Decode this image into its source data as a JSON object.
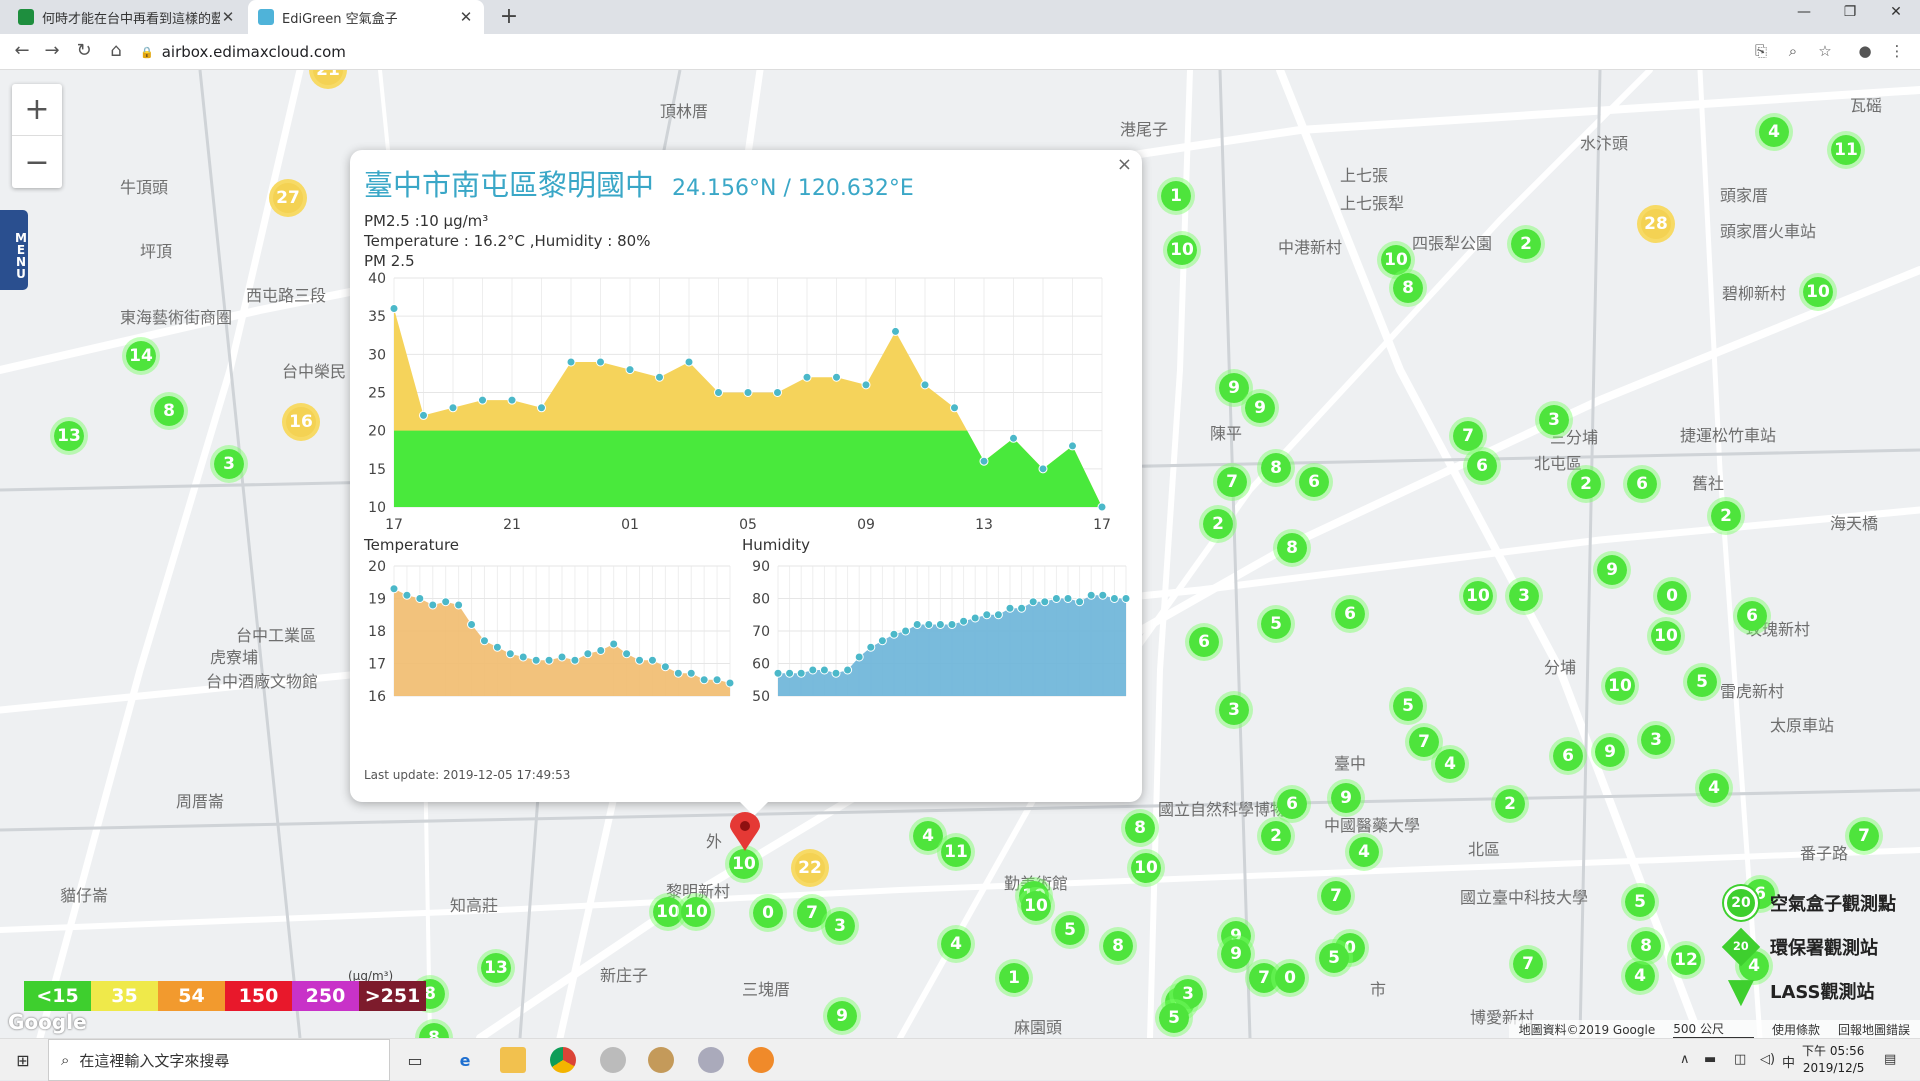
{
  "browser": {
    "tabs": [
      {
        "title": "何時才能在台中再看到這樣的藍天",
        "favicon_color": "#1e8e3e"
      },
      {
        "title": "EdiGreen 空氣盒子",
        "favicon_color": "#4fb3d9"
      }
    ],
    "url": "airbox.edimaxcloud.com"
  },
  "map": {
    "menu_label": "MENU",
    "zoom_in": "+",
    "zoom_out": "−",
    "places": [
      "頂林厝",
      "港尾子",
      "水汴頭",
      "瓦磘",
      "牛頂頭",
      "坪頂",
      "東海藝術街商圈",
      "西屯路三段",
      "上七張",
      "上七張犁",
      "中港新村",
      "四張犁公園",
      "頭家厝",
      "頭家厝火車站",
      "碧柳新村",
      "陳平",
      "北屯區",
      "三分埔",
      "捷運松竹車站",
      "舊社",
      "海天橋",
      "台中工業區",
      "虎寮埔",
      "台中酒廠文物館",
      "玫瑰新村",
      "分埔",
      "雷虎新村",
      "臺中",
      "太原車站",
      "周厝崙",
      "貓仔崙",
      "知高莊",
      "黎明新村",
      "三塊厝",
      "新庄子",
      "國立自然科學博物館",
      "中國醫藥大學",
      "北區",
      "國立臺中科技大學",
      "番子路",
      "勤美術館",
      "麻園頭",
      "博愛新村",
      "市",
      "外",
      "台中榮民"
    ],
    "markers": [
      {
        "v": "21",
        "c": "y"
      },
      {
        "v": "27",
        "c": "y"
      },
      {
        "v": "14",
        "c": "g"
      },
      {
        "v": "8",
        "c": "g"
      },
      {
        "v": "13",
        "c": "g"
      },
      {
        "v": "3",
        "c": "g"
      },
      {
        "v": "16",
        "c": "y"
      },
      {
        "v": "1",
        "c": "g"
      },
      {
        "v": "10",
        "c": "g"
      },
      {
        "v": "10",
        "c": "g"
      },
      {
        "v": "8",
        "c": "g"
      },
      {
        "v": "2",
        "c": "g"
      },
      {
        "v": "28",
        "c": "y"
      },
      {
        "v": "10",
        "c": "g"
      },
      {
        "v": "4",
        "c": "g"
      },
      {
        "v": "11",
        "c": "g"
      },
      {
        "v": "9",
        "c": "g"
      },
      {
        "v": "9",
        "c": "g"
      },
      {
        "v": "7",
        "c": "g"
      },
      {
        "v": "6",
        "c": "g"
      },
      {
        "v": "3",
        "c": "g"
      },
      {
        "v": "2",
        "c": "g"
      },
      {
        "v": "6",
        "c": "g"
      },
      {
        "v": "2",
        "c": "g"
      },
      {
        "v": "7",
        "c": "g"
      },
      {
        "v": "8",
        "c": "g"
      },
      {
        "v": "6",
        "c": "g"
      },
      {
        "v": "2",
        "c": "g"
      },
      {
        "v": "8",
        "c": "g"
      },
      {
        "v": "9",
        "c": "g"
      },
      {
        "v": "10",
        "c": "g"
      },
      {
        "v": "3",
        "c": "g"
      },
      {
        "v": "0",
        "c": "g"
      },
      {
        "v": "10",
        "c": "g"
      },
      {
        "v": "6",
        "c": "g"
      },
      {
        "v": "5",
        "c": "g"
      },
      {
        "v": "6",
        "c": "g"
      },
      {
        "v": "6",
        "c": "g"
      },
      {
        "v": "3",
        "c": "g"
      },
      {
        "v": "5",
        "c": "g"
      },
      {
        "v": "7",
        "c": "g"
      },
      {
        "v": "4",
        "c": "g"
      },
      {
        "v": "10",
        "c": "g"
      },
      {
        "v": "9",
        "c": "g"
      },
      {
        "v": "3",
        "c": "g"
      },
      {
        "v": "6",
        "c": "g"
      },
      {
        "v": "5",
        "c": "g"
      },
      {
        "v": "2",
        "c": "g"
      },
      {
        "v": "4",
        "c": "g"
      },
      {
        "v": "6",
        "c": "g"
      },
      {
        "v": "9",
        "c": "g"
      },
      {
        "v": "2",
        "c": "g"
      },
      {
        "v": "4",
        "c": "g"
      },
      {
        "v": "7",
        "c": "g"
      },
      {
        "v": "0",
        "c": "g"
      },
      {
        "v": "4",
        "c": "g"
      },
      {
        "v": "11",
        "c": "g"
      },
      {
        "v": "8",
        "c": "g"
      },
      {
        "v": "10",
        "c": "g"
      },
      {
        "v": "10",
        "c": "g"
      },
      {
        "v": "0",
        "c": "g"
      },
      {
        "v": "7",
        "c": "g"
      },
      {
        "v": "3",
        "c": "g"
      },
      {
        "v": "10",
        "c": "g"
      },
      {
        "v": "10",
        "c": "g"
      },
      {
        "v": "8",
        "c": "g"
      },
      {
        "v": "5",
        "c": "g"
      },
      {
        "v": "6",
        "c": "g"
      },
      {
        "v": "10",
        "c": "g"
      },
      {
        "v": "5",
        "c": "g"
      },
      {
        "v": "8",
        "c": "g"
      },
      {
        "v": "4",
        "c": "g"
      },
      {
        "v": "1",
        "c": "g"
      },
      {
        "v": "9",
        "c": "g"
      },
      {
        "v": "9",
        "c": "g"
      },
      {
        "v": "7",
        "c": "g"
      },
      {
        "v": "0",
        "c": "g"
      },
      {
        "v": "5",
        "c": "g"
      },
      {
        "v": "8",
        "c": "g"
      },
      {
        "v": "3",
        "c": "g"
      },
      {
        "v": "5",
        "c": "g"
      },
      {
        "v": "7",
        "c": "g"
      },
      {
        "v": "4",
        "c": "g"
      },
      {
        "v": "8",
        "c": "g"
      },
      {
        "v": "12",
        "c": "g"
      },
      {
        "v": "4",
        "c": "g"
      },
      {
        "v": "7",
        "c": "g"
      },
      {
        "v": "13",
        "c": "g"
      },
      {
        "v": "8",
        "c": "g"
      },
      {
        "v": "9",
        "c": "g"
      },
      {
        "v": "22",
        "c": "y"
      },
      {
        "v": "10",
        "c": "g"
      }
    ]
  },
  "popup": {
    "title": "臺中市南屯區黎明國中",
    "coords": "24.156°N / 120.632°E",
    "pm_line": "PM2.5 :10 μg/m³",
    "temp_line": "Temperature : 16.2°C ,Humidity : 80%",
    "chart_label": "PM 2.5",
    "temp_label": "Temperature",
    "hum_label": "Humidity",
    "last_update": "Last update: 2019-12-05 17:49:53",
    "close": "×"
  },
  "chart_data": [
    {
      "type": "area",
      "title": "PM 2.5",
      "x_ticks": [
        "17",
        "21",
        "01",
        "05",
        "09",
        "13",
        "17"
      ],
      "ylim": [
        10,
        40
      ],
      "y_ticks": [
        10,
        15,
        20,
        25,
        30,
        35,
        40
      ],
      "values": [
        36,
        22,
        23,
        24,
        24,
        23,
        29,
        29,
        28,
        27,
        29,
        25,
        25,
        25,
        27,
        27,
        26,
        33,
        26,
        23,
        16,
        19,
        15,
        18,
        10
      ],
      "threshold": 20,
      "colors": {
        "above": "#f5d35b",
        "below": "#49e93c",
        "point": "#4bb8c9"
      }
    },
    {
      "type": "area",
      "title": "Temperature",
      "ylim": [
        16,
        20
      ],
      "y_ticks": [
        16,
        17,
        18,
        19,
        20
      ],
      "values": [
        19.3,
        19.1,
        19.0,
        18.8,
        18.9,
        18.8,
        18.2,
        17.7,
        17.5,
        17.3,
        17.2,
        17.1,
        17.1,
        17.2,
        17.1,
        17.3,
        17.4,
        17.6,
        17.3,
        17.1,
        17.1,
        16.9,
        16.7,
        16.7,
        16.5,
        16.5,
        16.4
      ],
      "colors": {
        "fill": "#f1bb6e",
        "point": "#4bb8c9"
      }
    },
    {
      "type": "area",
      "title": "Humidity",
      "ylim": [
        50,
        90
      ],
      "y_ticks": [
        50,
        60,
        70,
        80,
        90
      ],
      "values": [
        57,
        57,
        57,
        58,
        58,
        57,
        58,
        62,
        65,
        67,
        69,
        70,
        72,
        72,
        72,
        72,
        73,
        74,
        75,
        75,
        77,
        77,
        79,
        79,
        80,
        80,
        79,
        81,
        81,
        80,
        80
      ],
      "colors": {
        "fill": "#6ab4d8",
        "point": "#4bb8c9"
      }
    }
  ],
  "legend": {
    "unit": "(μg/m³)",
    "bands": [
      {
        "label": "<15",
        "color": "#3ecf2e"
      },
      {
        "label": "35",
        "color": "#efe94a"
      },
      {
        "label": "54",
        "color": "#f29a2e"
      },
      {
        "label": "150",
        "color": "#e8182b"
      },
      {
        "label": "250",
        "color": "#c832c8"
      },
      {
        "label": ">251",
        "color": "#7d1b2c"
      }
    ]
  },
  "key_legend": [
    {
      "label": "空氣盒子觀測點",
      "value": "20"
    },
    {
      "label": "環保署觀測站",
      "value": "20"
    },
    {
      "label": "LASS觀測站",
      "value": "20"
    }
  ],
  "attribution": [
    "地圖資料©2019 Google",
    "500 公尺",
    "使用條款",
    "回報地圖錯誤"
  ],
  "google_logo": "Google",
  "taskbar": {
    "search_placeholder": "在這裡輸入文字來搜尋",
    "time": "下午 05:56",
    "date": "2019/12/5",
    "ime": "中"
  }
}
